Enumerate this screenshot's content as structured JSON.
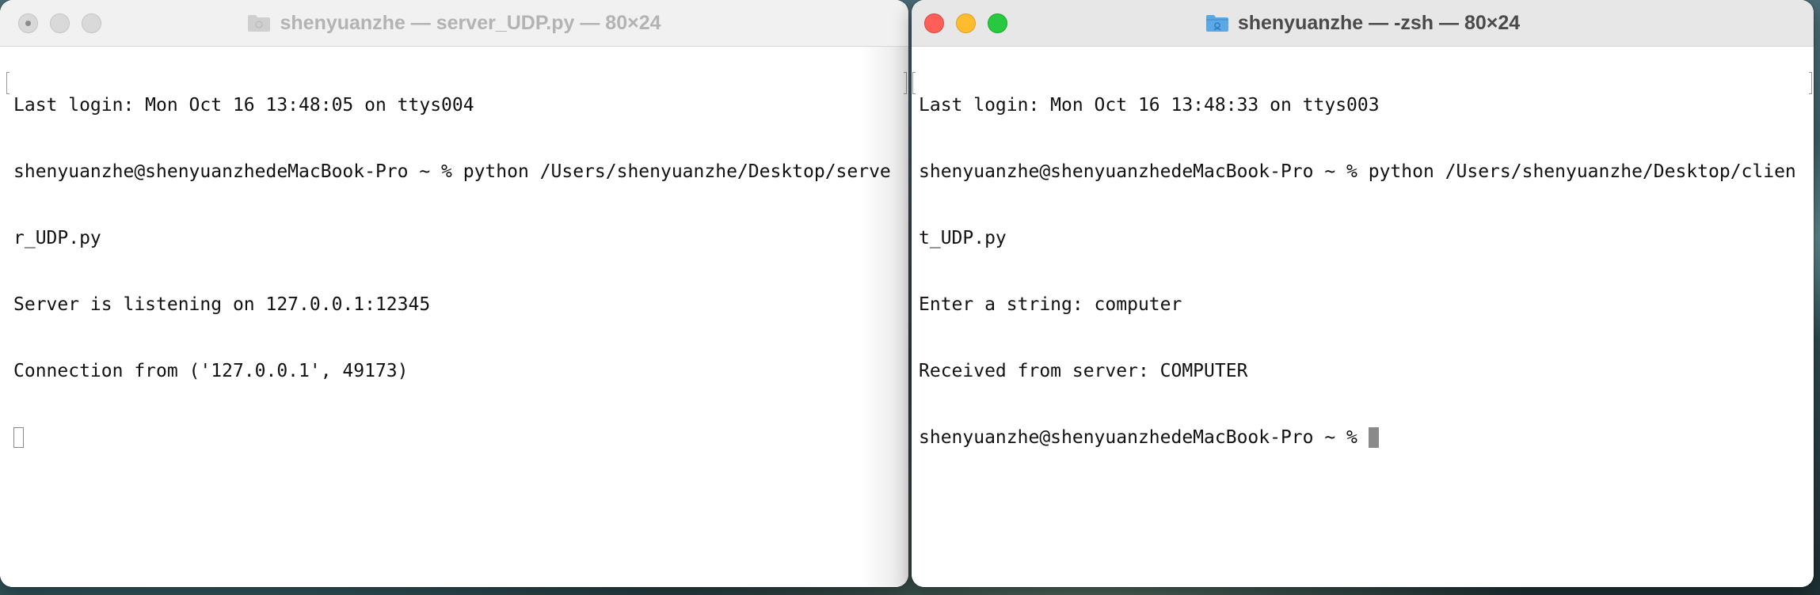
{
  "left_window": {
    "title": "shenyuanzhe — server_UDP.py — 80×24",
    "title_icon": "folder-icon",
    "lines": [
      "Last login: Mon Oct 16 13:48:05 on ttys004",
      "shenyuanzhe@shenyuanzhedeMacBook-Pro ~ % python /Users/shenyuanzhe/Desktop/serve",
      "r_UDP.py",
      "Server is listening on 127.0.0.1:12345",
      "Connection from ('127.0.0.1', 49173)"
    ]
  },
  "right_window": {
    "title": "shenyuanzhe — -zsh — 80×24",
    "title_icon": "folder-icon",
    "lines": [
      "Last login: Mon Oct 16 13:48:33 on ttys003",
      "shenyuanzhe@shenyuanzhedeMacBook-Pro ~ % python /Users/shenyuanzhe/Desktop/clien",
      "t_UDP.py",
      "Enter a string: computer",
      "Received from server: COMPUTER",
      "shenyuanzhe@shenyuanzhedeMacBook-Pro ~ % "
    ]
  },
  "colors": {
    "close": "#ff5f57",
    "minimize": "#febc2e",
    "zoom": "#28c840",
    "inactive_button": "#d9d9d9",
    "folder": "#5aa9e6"
  }
}
